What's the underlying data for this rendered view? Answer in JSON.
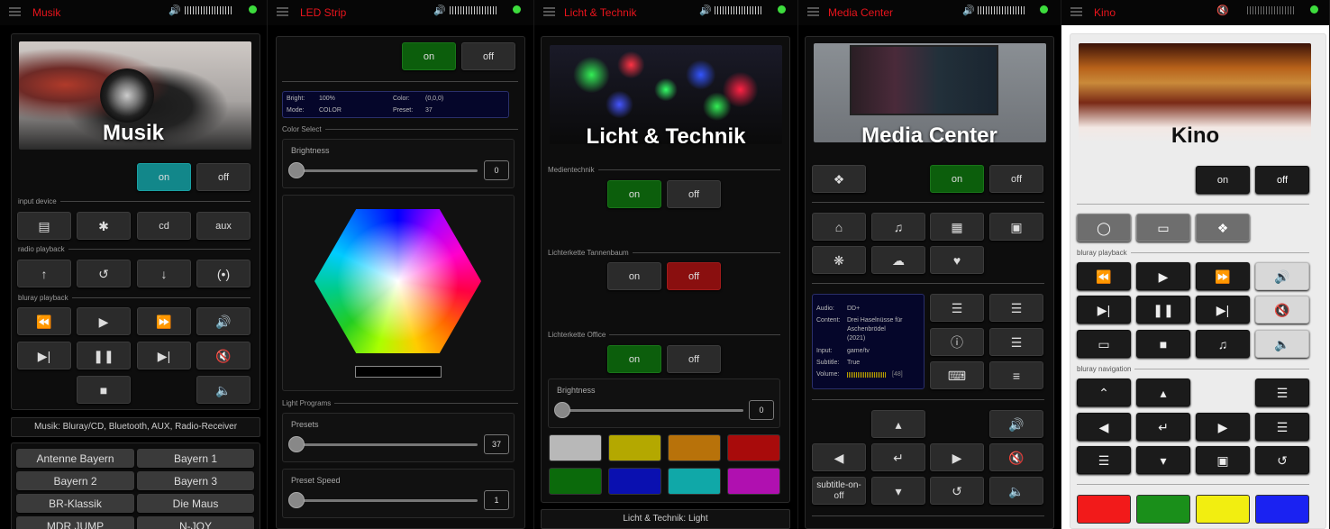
{
  "musik": {
    "title": "Musik",
    "hero_title": "Musik",
    "on": "on",
    "off": "off",
    "sec_input": "input device",
    "sec_radio": "radio playback",
    "sec_bluray": "bluray playback",
    "input_buttons": [
      "⊙",
      "✱",
      "cd",
      "aux"
    ],
    "status": "Musik: Bluray/CD, Bluetooth, AUX, Radio-Receiver",
    "stations": [
      "Antenne Bayern",
      "Bayern 1",
      "Bayern 2",
      "Bayern 3",
      "BR-Klassik",
      "Die Maus",
      "MDR JUMP",
      "N-JOY"
    ]
  },
  "led": {
    "title": "LED Strip",
    "on": "on",
    "off": "off",
    "info": {
      "bright_label": "Bright:",
      "bright_val": "100%",
      "mode_label": "Mode:",
      "mode_val": "COLOR",
      "color_label": "Color:",
      "color_val": "(0,0,0)",
      "preset_label": "Preset:",
      "preset_val": "37"
    },
    "sec_color": "Color Select",
    "brightness_label": "Brightness",
    "brightness_val": "0",
    "sec_programs": "Light Programs",
    "presets_label": "Presets",
    "presets_val": "37",
    "speed_label": "Preset Speed",
    "speed_val": "1"
  },
  "licht": {
    "title": "Licht & Technik",
    "hero_title": "Licht & Technik",
    "sec1": "Medientechnik",
    "sec2": "Lichterkette Tannenbaum",
    "sec3": "Lichterkette Office",
    "on": "on",
    "off": "off",
    "brightness_label": "Brightness",
    "brightness_val": "0",
    "swatches": [
      "#b8b8b8",
      "#b4a800",
      "#b8720a",
      "#a80b0b",
      "#0b6a0b",
      "#0a10b0",
      "#10a8a8",
      "#b010b0"
    ],
    "status": "Licht & Technik: Light"
  },
  "media": {
    "title": "Media Center",
    "hero_title": "Media Center",
    "on": "on",
    "off": "off",
    "info": {
      "audio_label": "Audio:",
      "audio_val": "DD+",
      "content_label": "Content:",
      "content_val1": "Drei Haselnüsse für",
      "content_val2": "Aschenbrödel",
      "content_val3": "(2021)",
      "input_label": "Input:",
      "input_val": "game/tv",
      "subtitle_label": "Subtitle:",
      "subtitle_val": "True",
      "volume_label": "Volume:",
      "volume_val": "[48]"
    },
    "subtitle_btn_1": "subtitle-on-",
    "subtitle_btn_2": "off"
  },
  "kino": {
    "title": "Kino",
    "hero_title": "Kino",
    "on": "on",
    "off": "off",
    "sec_playback": "bluray playback",
    "sec_nav": "bluray navigation",
    "swatches": [
      "#f21a1a",
      "#1a8f1a",
      "#f2ee10",
      "#1a22f2"
    ]
  },
  "colors": {
    "accent": "#e8141c",
    "status_green": "#3ddc3d",
    "on_green": "#0c5e0c",
    "on_teal": "#12878a",
    "off_red": "#8a0f0f"
  }
}
